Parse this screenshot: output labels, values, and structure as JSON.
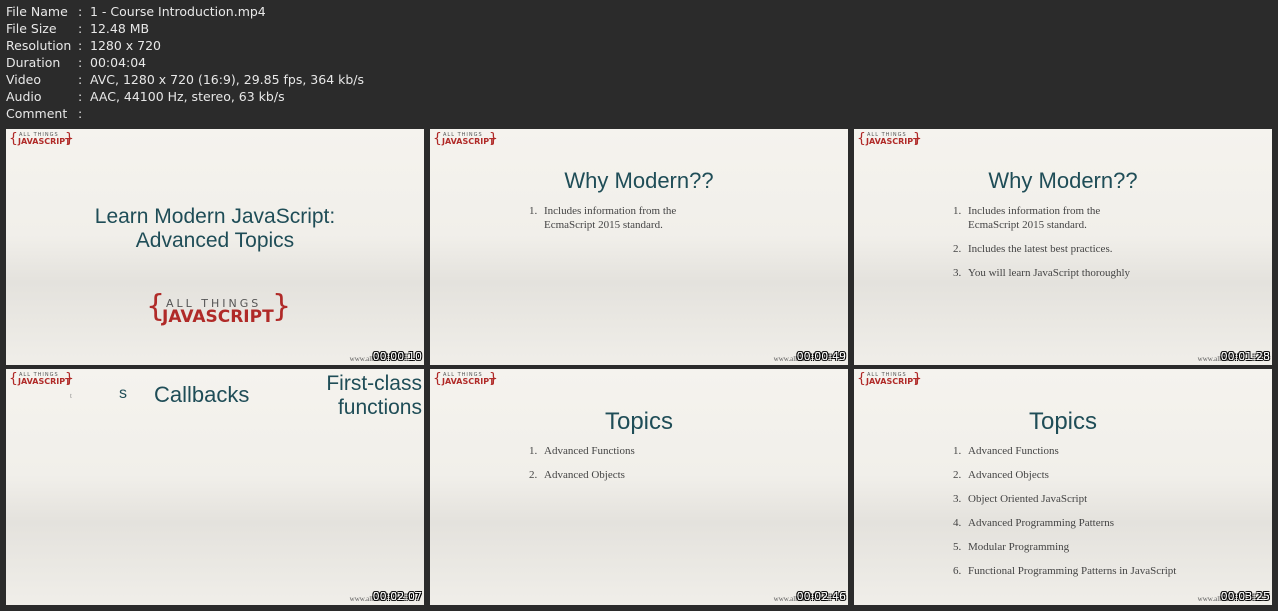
{
  "file_info": [
    {
      "key": "File Name",
      "value": "1 - Course Introduction.mp4"
    },
    {
      "key": "File Size",
      "value": "12.48 MB"
    },
    {
      "key": "Resolution",
      "value": "1280 x 720"
    },
    {
      "key": "Duration",
      "value": "00:04:04"
    },
    {
      "key": "Video",
      "value": "AVC, 1280 x 720 (16:9), 29.85 fps, 364 kb/s"
    },
    {
      "key": "Audio",
      "value": "AAC, 44100 Hz, stereo, 63 kb/s"
    },
    {
      "key": "Comment",
      "value": ""
    }
  ],
  "separator": ":",
  "logo": {
    "top": "ALL THINGS",
    "bottom": "JAVASCRIPT"
  },
  "footer_url": "www.allthin",
  "thumbnails": [
    {
      "timestamp": "00:00:10",
      "title": "Learn Modern JavaScript:",
      "title2": "Advanced Topics"
    },
    {
      "timestamp": "00:00:49",
      "title": "Why Modern??",
      "items": [
        "Includes information from the EcmaScript 2015 standard."
      ]
    },
    {
      "timestamp": "00:01:28",
      "title": "Why Modern??",
      "items": [
        "Includes information from the EcmaScript 2015 standard.",
        "Includes the latest best practices.",
        "You will learn JavaScript thoroughly"
      ]
    },
    {
      "timestamp": "00:02:07",
      "callbacks": "Callbacks",
      "first_class_1": "First-class",
      "first_class_2": "functions",
      "partial": "t",
      "partial2": "s"
    },
    {
      "timestamp": "00:02:46",
      "title": "Topics",
      "items": [
        "Advanced Functions",
        "Advanced Objects"
      ]
    },
    {
      "timestamp": "00:03:25",
      "title": "Topics",
      "items": [
        "Advanced Functions",
        "Advanced Objects",
        "Object Oriented JavaScript",
        "Advanced Programming Patterns",
        "Modular Programming",
        "Functional Programming Patterns in JavaScript"
      ]
    }
  ]
}
